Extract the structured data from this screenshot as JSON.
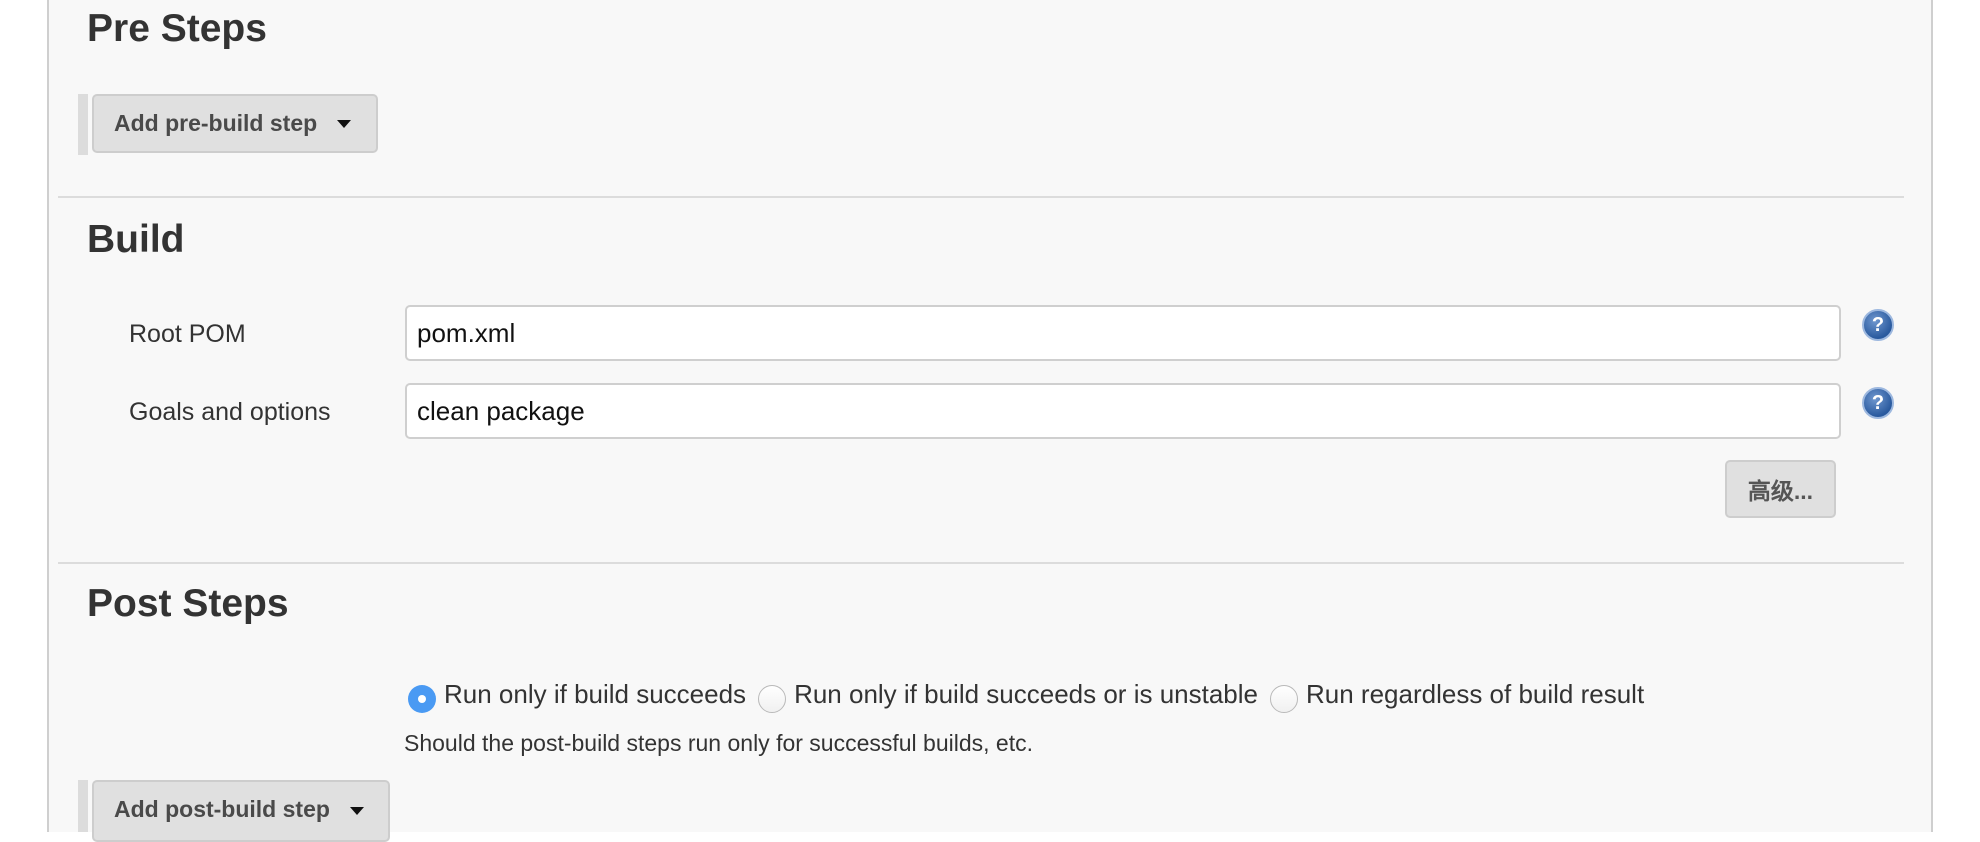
{
  "pre_steps": {
    "heading": "Pre Steps",
    "add_button": "Add pre-build step"
  },
  "build": {
    "heading": "Build",
    "fields": [
      {
        "label": "Root POM",
        "value": "pom.xml",
        "help_icon": "help-icon"
      },
      {
        "label": "Goals and options",
        "value": "clean package",
        "help_icon": "help-icon"
      }
    ],
    "advanced_button": "高级...",
    "help_glyph": "?"
  },
  "post_steps": {
    "heading": "Post Steps",
    "options": [
      {
        "label": "Run only if build succeeds",
        "selected": true
      },
      {
        "label": "Run only if build succeeds or is unstable",
        "selected": false
      },
      {
        "label": "Run regardless of build result",
        "selected": false
      }
    ],
    "description": "Should the post-build steps run only for successful builds, etc.",
    "add_button": "Add post-build step"
  },
  "colors": {
    "panel_bg": "#f8f8f8",
    "radio_selected": "#4a9af3",
    "button_bg": "#e0e0e0"
  }
}
